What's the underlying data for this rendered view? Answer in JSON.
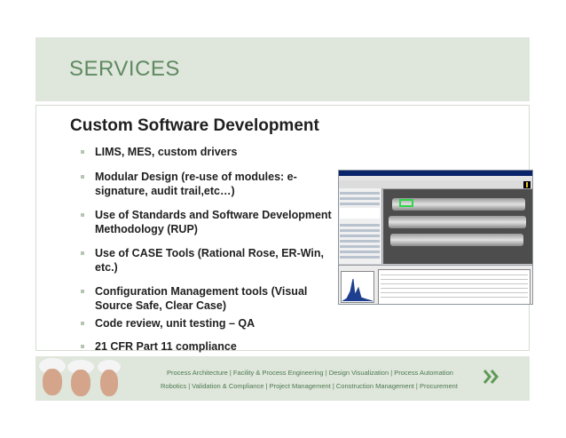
{
  "header": {
    "title": "SERVICES"
  },
  "main": {
    "heading": "Custom Software Development",
    "bullets": [
      "LIMS, MES, custom drivers",
      "Modular Design (re-use of modules: e-signature, audit trail,etc…)",
      "Use of Standards and Software Development Methodology (RUP)",
      "Use of CASE Tools (Rational Rose, ER-Win, etc.)",
      "Configuration Management tools (Visual Source Safe, Clear Case)",
      "Code review, unit testing – QA",
      "21 CFR Part 11 compliance"
    ]
  },
  "footer": {
    "line1": "Process Architecture | Facility & Process Engineering | Design Visualization | Process Automation",
    "line2": "Robotics | Validation & Compliance | Project Management | Construction Management | Procurement"
  },
  "colors": {
    "accent_green": "#5f8a61",
    "band_background": "#dfe6dc",
    "bullet_marker": "#b5c5b2"
  },
  "icons": [
    "bullet-square-icon",
    "double-chevron-logo-icon"
  ]
}
